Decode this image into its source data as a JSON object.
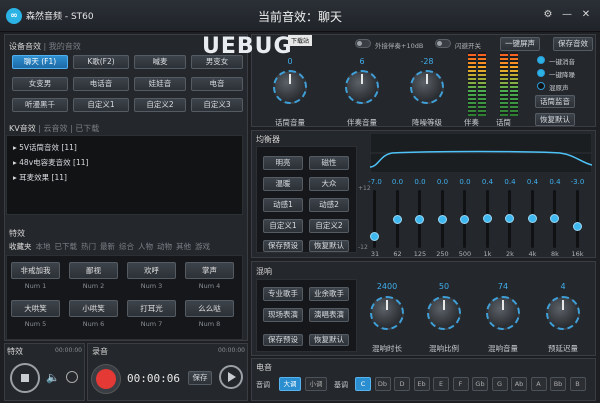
{
  "app": {
    "name": "森然音频 - ST60",
    "now_playing_prefix": "当前音效：",
    "now_playing": "聊天",
    "logo_glyph": "∞"
  },
  "titlebar": {
    "icons": [
      "gear-icon",
      "minimize-icon",
      "close-icon"
    ],
    "glyphs": [
      "⚙",
      "—",
      "✕"
    ]
  },
  "watermark": {
    "logo_text": "UEBUG",
    "tag": "下载站"
  },
  "device_effects": {
    "header": "设备音效",
    "header_sep": "|",
    "header_alt": "我的音效",
    "buttons": [
      "聊天 (F1)",
      "K歌(F2)",
      "喊麦",
      "男变女",
      "女变男",
      "电话音",
      "娃娃音",
      "电音",
      "听漫黑千",
      "自定义1",
      "自定义2",
      "自定义3"
    ],
    "active_index": 0
  },
  "kv_effects": {
    "header": "KV音效",
    "tab1": "云音效",
    "tab2": "已下载",
    "tree": [
      "▸ 5V话筒音效 [11]",
      "▸ 48v电容麦音效 [11]",
      "▸ 耳麦效果 [11]"
    ]
  },
  "special": {
    "header": "特效",
    "tabs": [
      "收藏夹",
      "本地",
      "已下载",
      "热门",
      "最新",
      "综合",
      "人物",
      "动物",
      "其他",
      "游戏"
    ],
    "buttons": [
      {
        "label": "非戒加我",
        "num": "Num 1"
      },
      {
        "label": "鄙视",
        "num": "Num 2"
      },
      {
        "label": "欢呼",
        "num": "Num 3"
      },
      {
        "label": "掌声",
        "num": "Num 4"
      },
      {
        "label": "大哄笑",
        "num": "Num 5"
      },
      {
        "label": "小哄笑",
        "num": "Num 6"
      },
      {
        "label": "打耳光",
        "num": "Num 7"
      },
      {
        "label": "么么哒",
        "num": "Num 8"
      }
    ]
  },
  "player": {
    "effect_label": "特效",
    "effect_time": "00:00:00",
    "record_label": "录音",
    "record_time_top": "00:00:00",
    "time": "00:00:06",
    "save": "保存"
  },
  "top_controls": {
    "toggle1": "外接伴奏+10dB",
    "toggle2": "闪避开关",
    "btn_mute": "一键屏声",
    "btn_save": "保存音效",
    "knobs": [
      {
        "value": "0",
        "label": "话筒音量"
      },
      {
        "value": "6",
        "label": "伴奏音量"
      },
      {
        "value": "-28",
        "label": "降噪等级"
      }
    ],
    "meters": [
      "伴奏",
      "话筒"
    ],
    "options": [
      {
        "label": "一键消音",
        "on": true
      },
      {
        "label": "一键降噪",
        "on": true
      },
      {
        "label": "混原声",
        "on": false
      }
    ],
    "btn_monitor": "话筒监音",
    "btn_reset": "恢复默认"
  },
  "equalizer": {
    "header": "均衡器",
    "presets": [
      "明亮",
      "磁性",
      "温暖",
      "大众",
      "动感1",
      "动感2",
      "自定义1",
      "自定义2"
    ],
    "btn_save": "保存预设",
    "btn_reset": "恢复默认",
    "values": [
      "-7.0",
      "0.0",
      "0.0",
      "0.0",
      "0.0",
      "0.4",
      "0.4",
      "0.4",
      "0.4",
      "-3.0"
    ],
    "freqs": [
      "31",
      "62",
      "125",
      "250",
      "500",
      "1k",
      "2k",
      "4k",
      "8k",
      "16k"
    ],
    "scale_top": "+12",
    "scale_bottom": "-12"
  },
  "reverb": {
    "header": "混响",
    "presets": [
      "专业歌手",
      "业余歌手",
      "现场表演",
      "演唱表演"
    ],
    "btn_save": "保存预设",
    "btn_reset": "恢复默认",
    "knobs": [
      {
        "value": "2400",
        "label": "混响时长"
      },
      {
        "value": "50",
        "label": "混响比例"
      },
      {
        "value": "74",
        "label": "混响音量"
      },
      {
        "value": "4",
        "label": "预延迟量"
      }
    ]
  },
  "pitch": {
    "header": "电音",
    "tone_label": "音调",
    "major": "大调",
    "minor": "小调",
    "key_label": "基调",
    "keys": [
      "C",
      "Db",
      "D",
      "Eb",
      "E",
      "F",
      "Gb",
      "G",
      "Ab",
      "A",
      "Bb",
      "B"
    ],
    "active_key": 0
  },
  "colors": {
    "accent": "#2bb3e6",
    "record": "#e53935",
    "panel": "#24272b"
  }
}
